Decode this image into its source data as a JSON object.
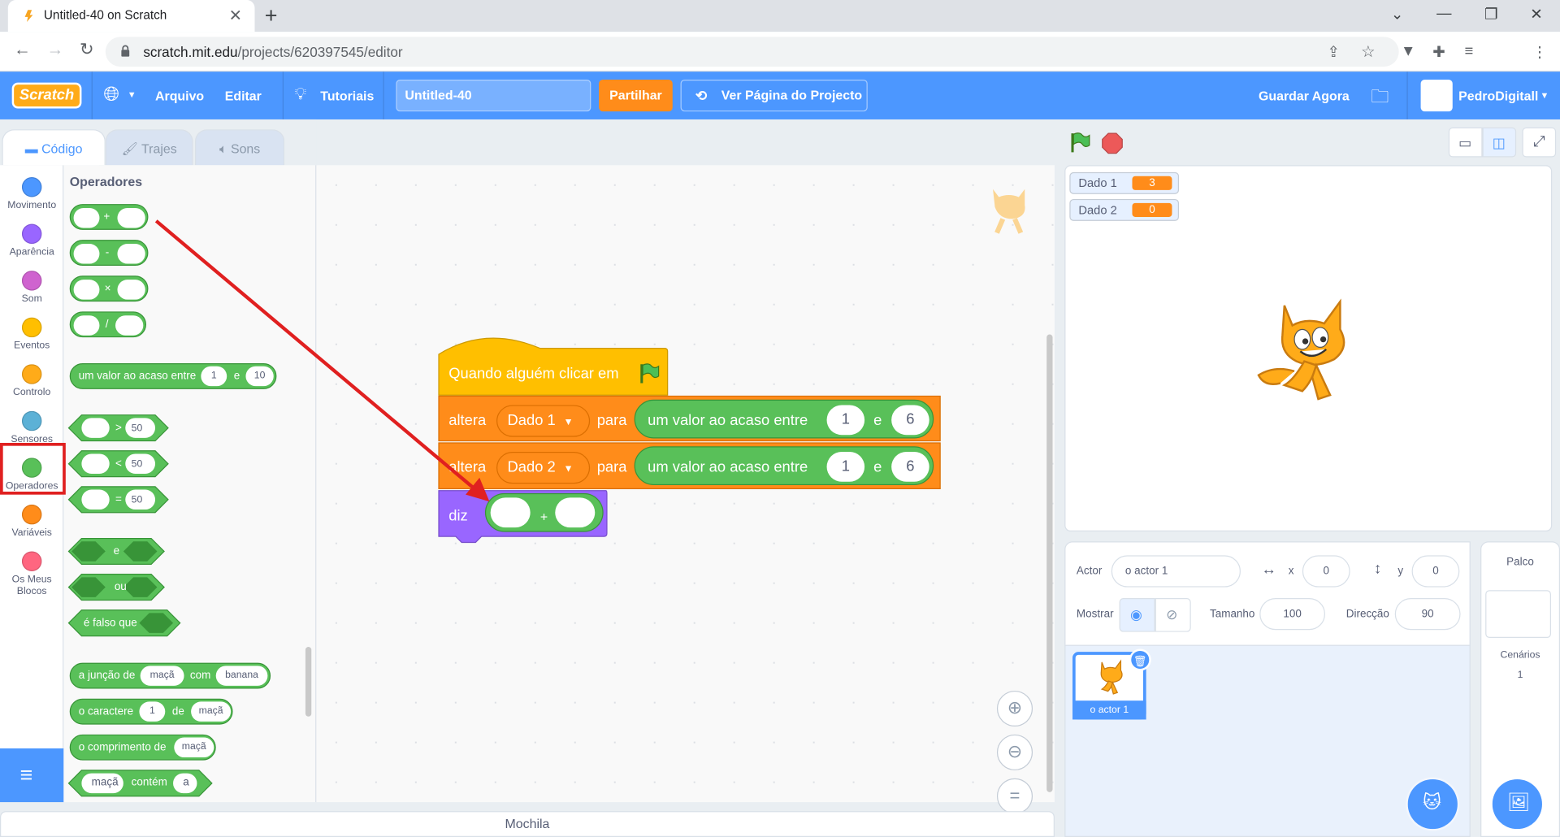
{
  "browser": {
    "tab_title": "Untitled-40 on Scratch",
    "url_host": "scratch.mit.edu",
    "url_path": "/projects/620397545/editor"
  },
  "menu": {
    "file": "Arquivo",
    "edit": "Editar",
    "tutorials": "Tutoriais",
    "project_title": "Untitled-40",
    "share": "Partilhar",
    "see_project": "Ver Página do Projecto",
    "save_now": "Guardar Agora",
    "username": "PedroDigitall"
  },
  "tabs": {
    "code": "Código",
    "costumes": "Trajes",
    "sounds": "Sons"
  },
  "categories": [
    {
      "label": "Movimento",
      "color": "#4c97ff"
    },
    {
      "label": "Aparência",
      "color": "#9966ff"
    },
    {
      "label": "Som",
      "color": "#cf63cf"
    },
    {
      "label": "Eventos",
      "color": "#ffbf00"
    },
    {
      "label": "Controlo",
      "color": "#ffab19"
    },
    {
      "label": "Sensores",
      "color": "#5cb1d6"
    },
    {
      "label": "Operadores",
      "color": "#59c059"
    },
    {
      "label": "Variáveis",
      "color": "#ff8c1a"
    },
    {
      "label": "Os Meus Blocos",
      "color": "#ff6680"
    }
  ],
  "palette": {
    "title": "Operadores",
    "ops": [
      "+",
      "-",
      "×",
      "/"
    ],
    "random": {
      "text": "um valor ao acaso entre",
      "from": "1",
      "and": "e",
      "to": "10"
    },
    "comparisons": [
      {
        "op": ">",
        "val": "50"
      },
      {
        "op": "<",
        "val": "50"
      },
      {
        "op": "=",
        "val": "50"
      }
    ],
    "and": "e",
    "or": "ou",
    "not": "é falso que",
    "join": {
      "text": "a junção de",
      "a": "maçã",
      "with": "com",
      "b": "banana"
    },
    "letter": {
      "text": "o caractere",
      "n": "1",
      "of": "de",
      "s": "maçã"
    },
    "length": {
      "text": "o comprimento de",
      "s": "maçã"
    },
    "contains": {
      "s": "maçã",
      "text": "contém",
      "c": "a"
    }
  },
  "script": {
    "hat": "Quando alguém clicar em",
    "set_label": "altera",
    "var1": "Dado 1",
    "var2": "Dado 2",
    "to": "para",
    "random_text": "um valor ao acaso entre",
    "from": "1",
    "and": "e",
    "to_value": "6",
    "say": "diz",
    "plus": "+"
  },
  "backpack": "Mochila",
  "monitors": [
    {
      "name": "Dado 1",
      "value": "3"
    },
    {
      "name": "Dado 2",
      "value": "0"
    }
  ],
  "sprite_info": {
    "sprite_label": "Actor",
    "sprite_name": "o actor 1",
    "x_label": "x",
    "x": "0",
    "y_label": "y",
    "y": "0",
    "show_label": "Mostrar",
    "size_label": "Tamanho",
    "size": "100",
    "direction_label": "Direcção",
    "direction": "90"
  },
  "sprite_list": [
    {
      "name": "o actor 1"
    }
  ],
  "stage_panel": {
    "title": "Palco",
    "backdrops_label": "Cenários",
    "backdrops_count": "1"
  }
}
